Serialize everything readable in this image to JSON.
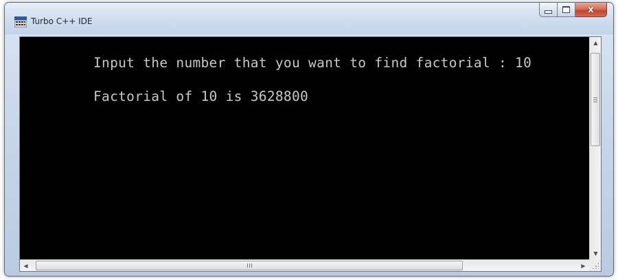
{
  "window": {
    "title": "Turbo C++ IDE",
    "icon": "turbo-cpp-app-icon"
  },
  "caption_buttons": {
    "minimize_icon": "minimize-icon",
    "maximize_icon": "maximize-icon",
    "close_icon": "close-icon",
    "close_glyph": "x"
  },
  "console": {
    "lines": [
      "Input the number that you want to find factorial : 10",
      "Factorial of 10 is 3628800"
    ],
    "background": "#000000",
    "foreground": "#c8c8c8"
  },
  "scrollbars": {
    "up_arrow": "▲",
    "down_arrow": "▼",
    "left_arrow": "◀",
    "right_arrow": "▶"
  },
  "colors": {
    "close_button": "#c2442c",
    "frame": "#c9d8ea"
  }
}
